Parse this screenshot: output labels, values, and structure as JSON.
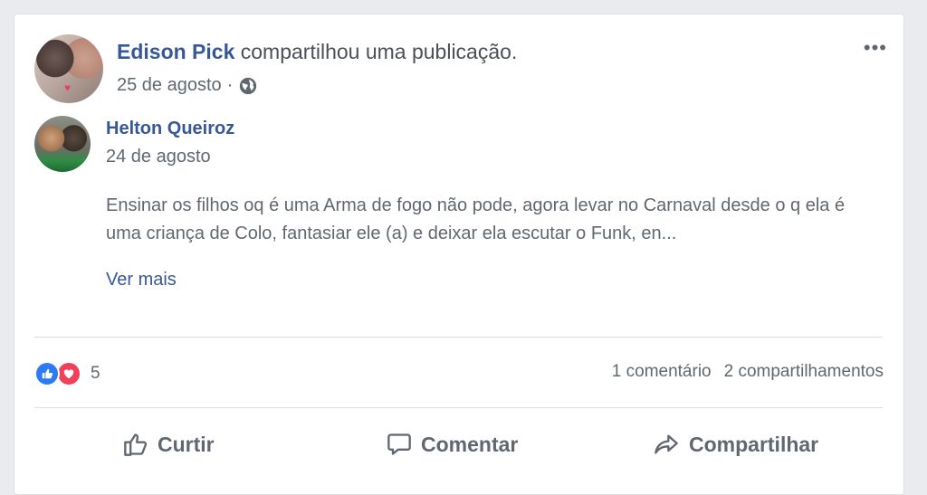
{
  "post": {
    "author": "Edison Pick",
    "action_text": "compartilhou uma publicação.",
    "date": "25 de agosto",
    "separator": "·"
  },
  "shared": {
    "author": "Helton Queiroz",
    "date": "24 de agosto",
    "text": "Ensinar os filhos oq é uma Arma de fogo não pode, agora levar no Carnaval desde o q ela é uma criança de Colo, fantasiar ele (a) e deixar ela escutar o Funk, en...",
    "see_more": "Ver mais"
  },
  "reactions": {
    "count": "5",
    "comments": "1 comentário",
    "shares": "2 compartilhamentos"
  },
  "actions": {
    "like": "Curtir",
    "comment": "Comentar",
    "share": "Compartilhar"
  },
  "colors": {
    "link": "#365899",
    "like": "#2d7bf4",
    "love": "#f0405a"
  }
}
